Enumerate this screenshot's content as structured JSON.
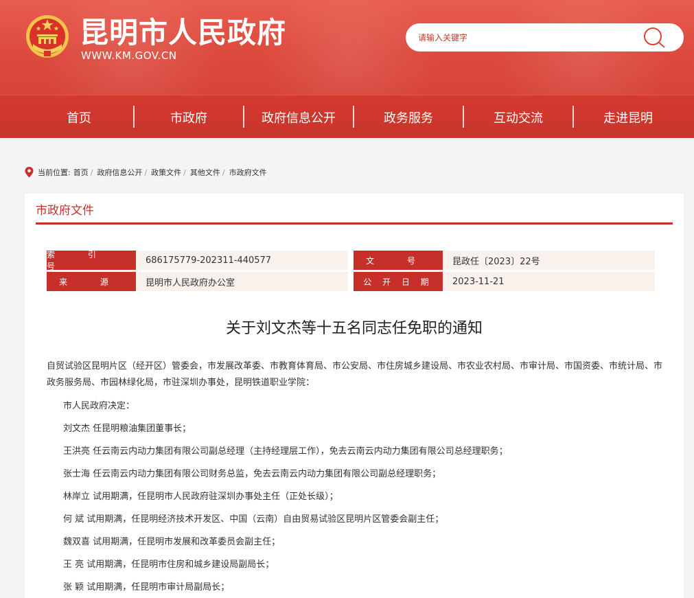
{
  "site": {
    "name": "昆明市人民政府",
    "domain": "WWW.KM.GOV.CN",
    "search_placeholder": "请输入关键字"
  },
  "nav": {
    "items": [
      "首页",
      "市政府",
      "政府信息公开",
      "政务服务",
      "互动交流",
      "走进昆明"
    ]
  },
  "breadcrumb": {
    "label": "当前位置:",
    "items": [
      "首页",
      "政府信息公开",
      "政策文件",
      "其他文件",
      "市政府文件"
    ]
  },
  "section": {
    "title": "市政府文件"
  },
  "meta": {
    "index_label": "索 引 号",
    "index_value": "686175779-202311-440577",
    "docno_label": "文 号",
    "docno_value": "昆政任〔2023〕22号",
    "source_label": "来 源",
    "source_value": "昆明市人民政府办公室",
    "date_label": "公 开 日 期",
    "date_value": "2023-11-21"
  },
  "document": {
    "title": "关于刘文杰等十五名同志任免职的通知",
    "lead": "自贸试验区昆明片区（经开区）管委会，市发展改革委、市教育体育局、市公安局、市住房城乡建设局、市农业农村局、市审计局、市国资委、市统计局、市政务服务局、市园林绿化局，市驻深圳办事处，昆明铁道职业学院：",
    "paragraphs": [
      "市人民政府决定：",
      "刘文杰  任昆明粮油集团董事长；",
      "王洪亮  任云南云内动力集团有限公司副总经理（主持经理层工作），免去云南云内动力集团有限公司总经理职务；",
      "张士海  任云南云内动力集团有限公司财务总监，免去云南云内动力集团有限公司副总经理职务；",
      "林岸立  试用期满，任昆明市人民政府驻深圳办事处主任（正处长级）；",
      "何  斌  试用期满，任昆明经济技术开发区、中国（云南）自由贸易试验区昆明片区管委会副主任；",
      "魏双喜  试用期满，任昆明市发展和改革委员会副主任；",
      "王  亮  试用期满，任昆明市住房和城乡建设局副局长；",
      "张  颖  试用期满，任昆明市审计局副局长；"
    ]
  },
  "colors": {
    "header_red": "#dd4a3e",
    "nav_red": "#c8352b",
    "accent_red": "#c7302a",
    "meta_value_bg": "#f9f2ec"
  },
  "icons": {
    "emblem": "national-emblem-icon",
    "search": "search-icon",
    "location": "location-pin-icon"
  }
}
